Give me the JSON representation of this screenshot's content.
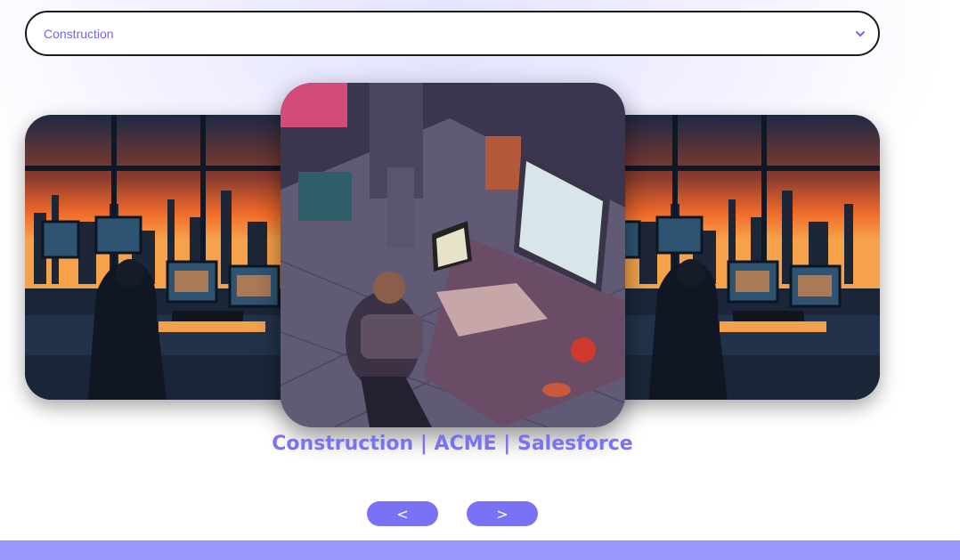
{
  "filter": {
    "selected": "Construction",
    "icon": "chevron-down-icon"
  },
  "carousel": {
    "caption": "Construction | ACME | Salesforce",
    "prev_label": "<",
    "next_label": ">",
    "slides": [
      {
        "name": "side-slide-left",
        "scene": "industrial control room at sunset"
      },
      {
        "name": "center-slide",
        "scene": "isometric engineer workstation"
      },
      {
        "name": "side-slide-right",
        "scene": "industrial control room at sunset"
      }
    ]
  },
  "colors": {
    "accent": "#7a72f5",
    "caption": "#7b72f0",
    "footer": "#9b96fb",
    "select_text": "#7066ee"
  }
}
